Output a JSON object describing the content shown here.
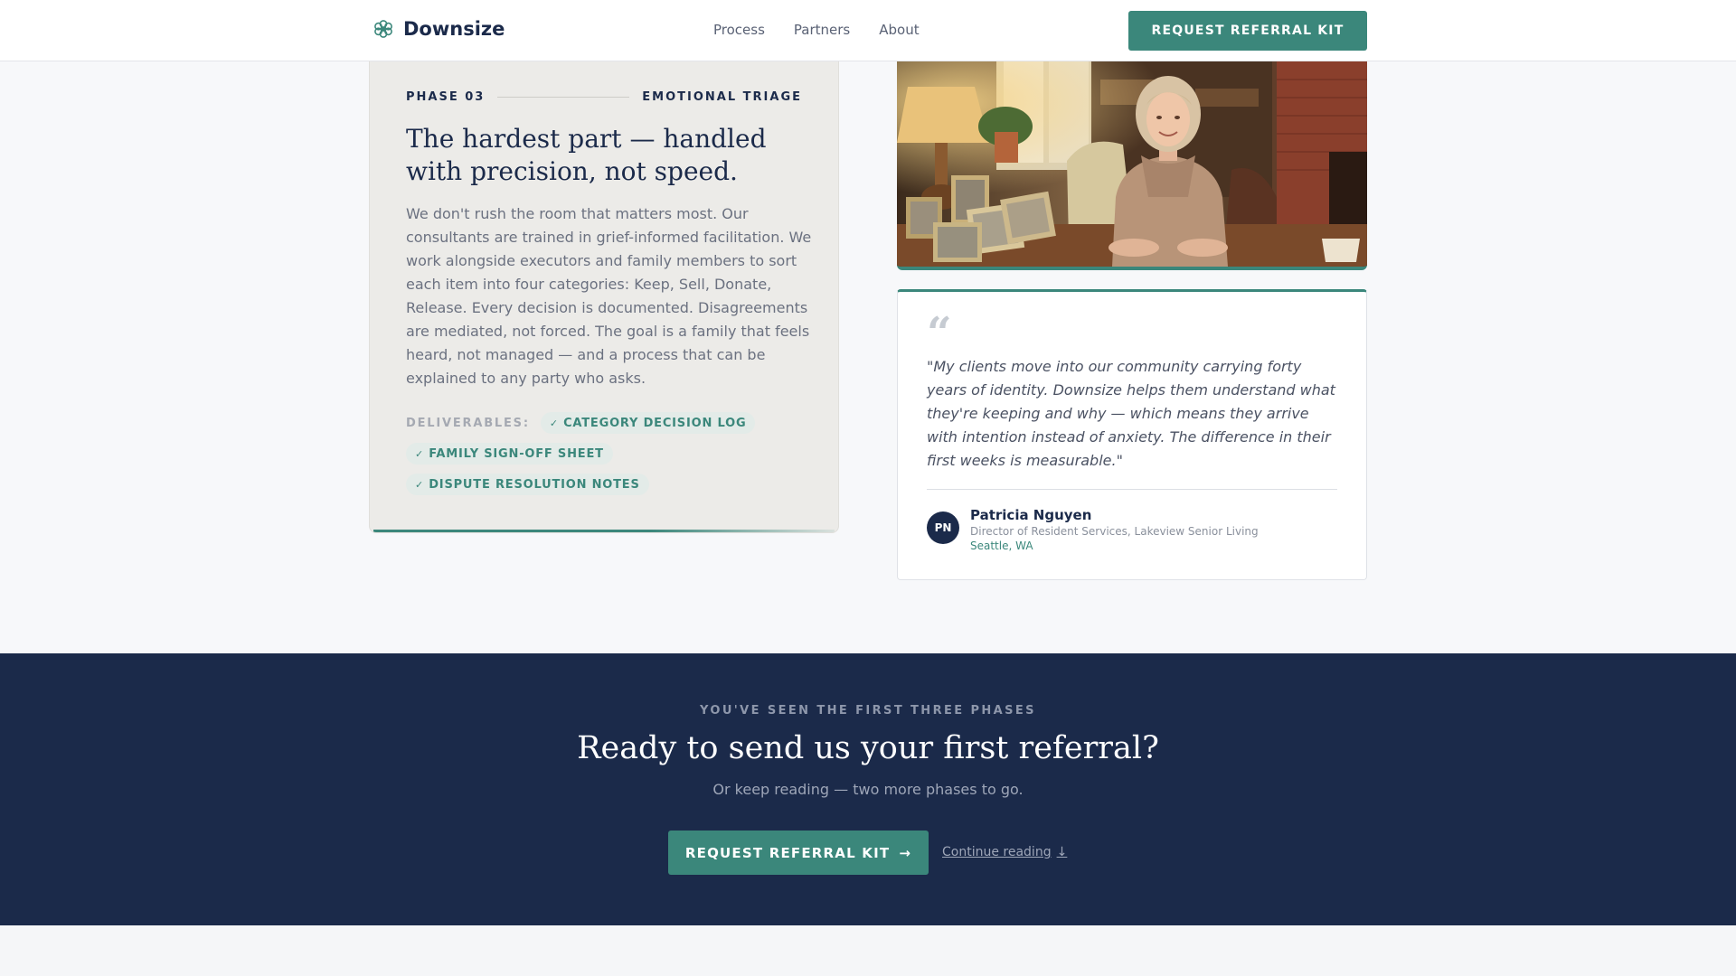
{
  "header": {
    "brand": "Downsize",
    "logo_icon": "flower-logo-icon",
    "nav": [
      {
        "label": "Process"
      },
      {
        "label": "Partners"
      },
      {
        "label": "About"
      }
    ],
    "cta_label": "REQUEST REFERRAL KIT"
  },
  "phase": {
    "number": "PHASE 03",
    "name": "EMOTIONAL TRIAGE",
    "title": "The hardest part — handled with precision, not speed.",
    "body": "We don't rush the room that matters most. Our consultants are trained in grief-informed facilitation. We work alongside executors and family members to sort each item into four categories: Keep, Sell, Donate, Release. Every decision is documented. Disagreements are mediated, not forced. The goal is a family that feels heard, not managed — and a process that can be explained to any party who asks.",
    "deliverables_label": "DELIVERABLES:",
    "deliverables": [
      {
        "label": "CATEGORY DECISION LOG",
        "icon": "check-icon"
      },
      {
        "label": "FAMILY SIGN-OFF SHEET",
        "icon": "check-icon"
      },
      {
        "label": "DISPUTE RESOLUTION NOTES",
        "icon": "check-icon"
      }
    ]
  },
  "testimonial": {
    "quote_icon": "quote-icon",
    "quote": "\"My clients move into our community carrying forty years of identity. Downsize helps them understand what they're keeping and why — which means they arrive with intention instead of anxiety. The difference in their first weeks is measurable.\"",
    "author_initials": "PN",
    "author_name": "Patricia Nguyen",
    "author_role": "Director of Resident Services, Lakeview Senior Living",
    "author_location": "Seattle, WA"
  },
  "cta": {
    "eyebrow": "YOU'VE SEEN THE FIRST THREE PHASES",
    "heading": "Ready to send us your first referral?",
    "subtext": "Or keep reading — two more phases to go.",
    "button_label": "REQUEST REFERRAL KIT",
    "button_icon": "→",
    "link_label": "Continue reading",
    "link_icon": "↓"
  },
  "colors": {
    "accent": "#3b877b",
    "navy": "#1b2a4a",
    "card_bg": "#ecebe8",
    "page_bg": "#f7f8fa"
  }
}
